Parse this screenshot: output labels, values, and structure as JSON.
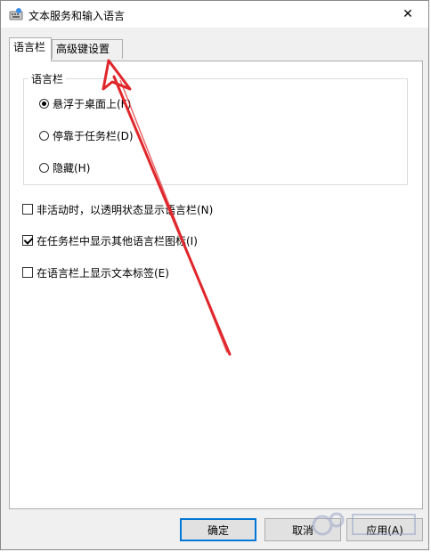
{
  "window": {
    "title": "文本服务和输入语言",
    "close_glyph": "✕"
  },
  "tabs": [
    {
      "label": "语言栏",
      "active": true
    },
    {
      "label": "高级键设置",
      "active": false
    }
  ],
  "language_bar_group": {
    "title": "语言栏",
    "options": [
      {
        "label": "悬浮于桌面上(F)",
        "checked": true
      },
      {
        "label": "停靠于任务栏(D)",
        "checked": false
      },
      {
        "label": "隐藏(H)",
        "checked": false
      }
    ]
  },
  "checkboxes": [
    {
      "label": "非活动时，以透明状态显示语言栏(N)",
      "checked": false
    },
    {
      "label": "在任务栏中显示其他语言栏图标(I)",
      "checked": true
    },
    {
      "label": "在语言栏上显示文本标签(E)",
      "checked": false
    }
  ],
  "buttons": {
    "ok": "确定",
    "cancel": "取消",
    "apply": "应用(A)"
  },
  "colors": {
    "accent": "#0078d7",
    "annotation_arrow": "#e0262b"
  }
}
